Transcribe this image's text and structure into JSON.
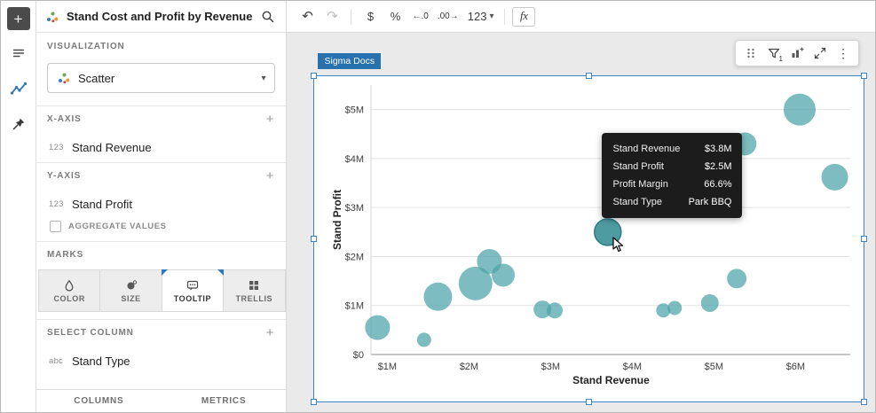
{
  "icons": {
    "plus": "+",
    "chevron_down": "▾",
    "undo": "↶",
    "redo": "↷",
    "kebab": "⋮"
  },
  "panel": {
    "title": "Stand Cost and Profit by Revenue",
    "visualization": {
      "label": "VISUALIZATION",
      "selected": "Scatter"
    },
    "x_axis": {
      "label": "X-AXIS",
      "field_badge": "123",
      "field_name": "Stand Revenue"
    },
    "y_axis": {
      "label": "Y-AXIS",
      "field_badge": "123",
      "field_name": "Stand Profit",
      "aggregate_label": "AGGREGATE VALUES",
      "aggregate_checked": false
    },
    "marks": {
      "label": "MARKS",
      "tabs": [
        {
          "label": "COLOR"
        },
        {
          "label": "SIZE"
        },
        {
          "label": "TOOLTIP"
        },
        {
          "label": "TRELLIS"
        }
      ],
      "active_tab": "TOOLTIP"
    },
    "select_column": {
      "label": "SELECT COLUMN",
      "field_badge": "abc",
      "field_name": "Stand Type"
    },
    "footer_tabs": [
      "COLUMNS",
      "METRICS"
    ]
  },
  "toolbar": {
    "currency": "$",
    "percent": "%",
    "decrease_decimal": "←.0",
    "increase_decimal": ".00→",
    "number_format": "123",
    "formula": "fx"
  },
  "canvas": {
    "element_tag": "Sigma Docs"
  },
  "element_toolbar": {
    "filter_badge": "1"
  },
  "tooltip": {
    "rows": [
      {
        "label": "Stand Revenue",
        "value": "$3.8M"
      },
      {
        "label": "Stand Profit",
        "value": "$2.5M"
      },
      {
        "label": "Profit Margin",
        "value": "66.6%"
      },
      {
        "label": "Stand Type",
        "value": "Park BBQ"
      }
    ]
  },
  "chart_data": {
    "type": "scatter",
    "title": "",
    "xlabel": "Stand Revenue",
    "ylabel": "Stand Profit",
    "x_unit": "$M",
    "y_unit": "$M",
    "x_ticks": [
      "$1M",
      "$2M",
      "$3M",
      "$4M",
      "$5M",
      "$6M"
    ],
    "x_tick_values": [
      1,
      2,
      3,
      4,
      5,
      6
    ],
    "y_ticks": [
      "$0",
      "$1M",
      "$2M",
      "$3M",
      "$4M",
      "$5M"
    ],
    "y_tick_values": [
      0,
      1,
      2,
      3,
      4,
      5
    ],
    "xlim": [
      0.8,
      6.67
    ],
    "ylim": [
      0,
      5.5
    ],
    "grid": "horizontal",
    "legend": false,
    "point_color": "#4ba2a8",
    "highlight_color": "#44969d",
    "highlight_stroke": "#2e7d84",
    "points": [
      {
        "x": 0.88,
        "y": 0.55,
        "r": 14
      },
      {
        "x": 1.45,
        "y": 0.3,
        "r": 8
      },
      {
        "x": 1.62,
        "y": 1.18,
        "r": 16
      },
      {
        "x": 2.08,
        "y": 1.45,
        "r": 19
      },
      {
        "x": 2.25,
        "y": 1.9,
        "r": 14
      },
      {
        "x": 2.42,
        "y": 1.62,
        "r": 13
      },
      {
        "x": 2.9,
        "y": 0.92,
        "r": 10
      },
      {
        "x": 3.05,
        "y": 0.9,
        "r": 9
      },
      {
        "x": 4.38,
        "y": 0.9,
        "r": 8
      },
      {
        "x": 4.52,
        "y": 0.95,
        "r": 8
      },
      {
        "x": 4.95,
        "y": 1.05,
        "r": 10
      },
      {
        "x": 5.28,
        "y": 1.55,
        "r": 11
      },
      {
        "x": 5.38,
        "y": 4.3,
        "r": 13
      },
      {
        "x": 6.05,
        "y": 5.0,
        "r": 18
      },
      {
        "x": 6.48,
        "y": 3.62,
        "r": 15
      }
    ],
    "highlight": {
      "x": 3.7,
      "y": 2.5,
      "r": 15
    }
  }
}
